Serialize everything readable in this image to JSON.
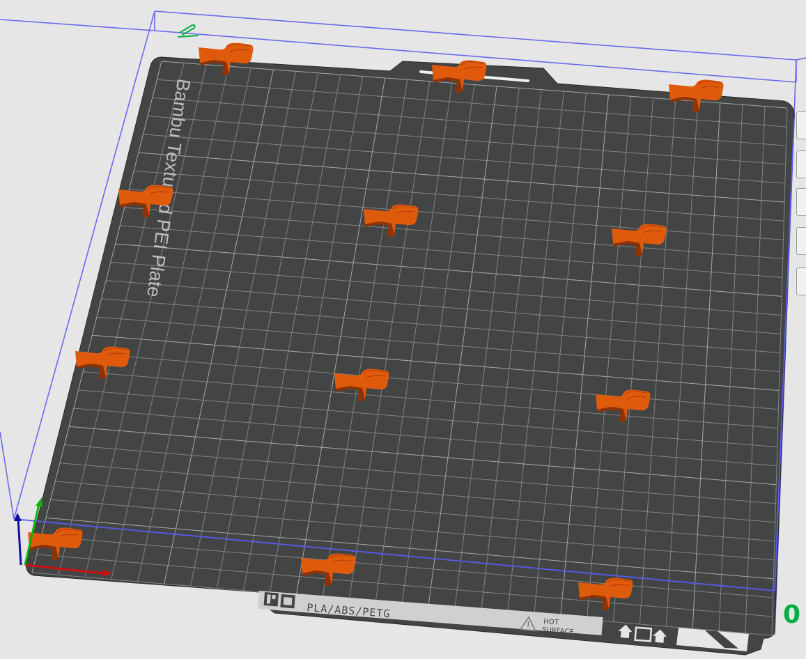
{
  "plate": {
    "name": "Bambu Textured PEI Plate",
    "materials": "PLA/ABS/PETG",
    "warning_line1": "HOT",
    "warning_line2": "SURFACE"
  },
  "plate_index": "0",
  "colors": {
    "background": "#e6e6e6",
    "plate": "#434444",
    "grid": "#8e9090",
    "bounding_box": "#6666ee",
    "part": "#e05a0c",
    "part_dark": "#8f3205",
    "accent": "#00ae42",
    "axis_x": "#d01010",
    "axis_y": "#10b010",
    "axis_z": "#1010a0"
  },
  "parts": [
    {
      "name": "clip-1"
    },
    {
      "name": "clip-2"
    },
    {
      "name": "clip-3"
    },
    {
      "name": "clip-4"
    },
    {
      "name": "clip-5"
    },
    {
      "name": "clip-6"
    },
    {
      "name": "clip-7"
    },
    {
      "name": "clip-8"
    },
    {
      "name": "clip-9"
    },
    {
      "name": "clip-10"
    },
    {
      "name": "clip-11"
    },
    {
      "name": "clip-12"
    }
  ],
  "side_toolbar": [
    {
      "name": "view-tool-button"
    },
    {
      "name": "auto-orient-tool-button"
    },
    {
      "name": "arrange-tool-button"
    },
    {
      "name": "plate-settings-tool-button"
    },
    {
      "name": "collapse-toolbar-button"
    }
  ]
}
